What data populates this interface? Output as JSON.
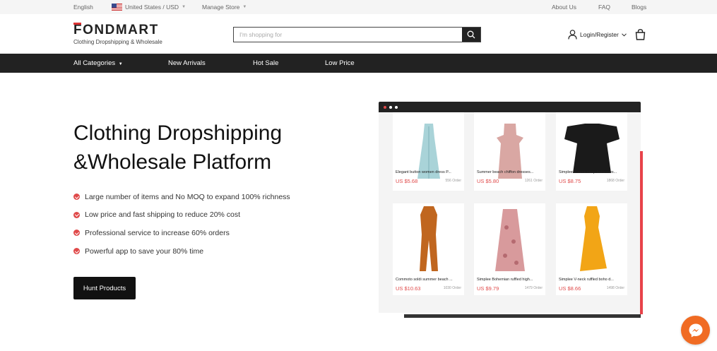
{
  "topbar": {
    "language": "English",
    "region": "United States / USD",
    "manage_store": "Manage Store",
    "about": "About Us",
    "faq": "FAQ",
    "blogs": "Blogs"
  },
  "header": {
    "logo": "FONDMART",
    "tagline": "Clothing Dropshipping & Wholesale",
    "search_placeholder": "I'm shopping for",
    "login": "Login/Register"
  },
  "nav": {
    "items": [
      "All Categories",
      "New Arrivals",
      "Hot Sale",
      "Low Price"
    ]
  },
  "hero": {
    "title_line1": "Clothing Dropshipping",
    "title_line2": "&Wholesale Platform",
    "features": [
      "Large number of items and No MOQ to expand 100% richness",
      "Low price and fast shipping to reduce 20% cost",
      "Professional service to increase 60% orders",
      "Powerful app to save your 80% time"
    ],
    "cta": "Hunt Products"
  },
  "products": [
    {
      "name": "Elegant button women dress P...",
      "price": "US $5.68",
      "orders": "556 Order",
      "color": "#a9d3d8"
    },
    {
      "name": "Summer beach chiffon dresses...",
      "price": "US $5.80",
      "orders": "1261 Order",
      "color": "#d9a7a3"
    },
    {
      "name": "Simplee V neck strap boho mes...",
      "price": "US $8.75",
      "orders": "1868 Order",
      "color": "#1a1a1a"
    },
    {
      "name": "Commoto soldi summer beach ...",
      "price": "US $10.63",
      "orders": "1030 Order",
      "color": "#c0661f"
    },
    {
      "name": "Simplee Bohemian ruffled high...",
      "price": "US $9.79",
      "orders": "1479 Order",
      "color": "#d89a9c"
    },
    {
      "name": "Simplee V-neck ruffled boho d...",
      "price": "US $8.66",
      "orders": "1498 Order",
      "color": "#f2a516"
    }
  ],
  "colors": {
    "accent": "#e04a4a",
    "dark": "#222222",
    "messenger": "#f06b23"
  }
}
